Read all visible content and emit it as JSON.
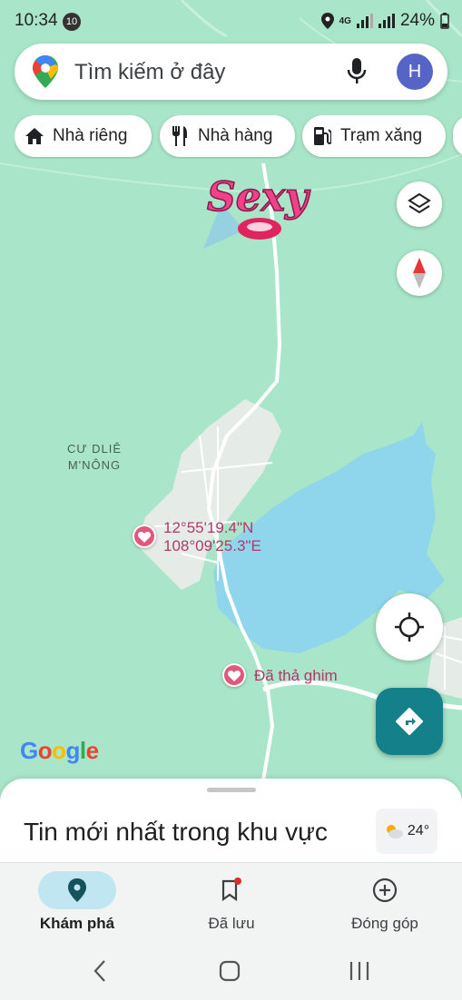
{
  "status_bar": {
    "time": "10:34",
    "notification_count": "10",
    "network": "4G",
    "battery": "24%"
  },
  "search": {
    "placeholder": "Tìm kiếm ở đây",
    "avatar_letter": "H"
  },
  "chips": [
    {
      "label": "Nhà riêng",
      "icon": "home-icon"
    },
    {
      "label": "Nhà hàng",
      "icon": "restaurant-icon"
    },
    {
      "label": "Trạm xăng",
      "icon": "gas-station-icon"
    }
  ],
  "map": {
    "place_label": [
      "CƯ DLIÊ",
      "M'NÔNG"
    ],
    "pins": [
      {
        "lines": [
          "12°55'19.4\"N",
          "108°09'25.3\"E"
        ]
      },
      {
        "lines": [
          "Đã thả ghim"
        ]
      }
    ],
    "sticker_text": "Sexy",
    "google_logo": "Google"
  },
  "sheet": {
    "title": "Tin mới nhất trong khu vực",
    "temperature": "24°"
  },
  "bottom_nav": [
    {
      "label": "Khám phá",
      "icon": "explore-pin-icon",
      "active": true
    },
    {
      "label": "Đã lưu",
      "icon": "saved-bookmark-icon",
      "active": false
    },
    {
      "label": "Đóng góp",
      "icon": "contribute-plus-icon",
      "active": false
    }
  ],
  "colors": {
    "map_green": "#a9e6c9",
    "water": "#8fd6ec",
    "accent_teal": "#14808a",
    "pin_pink": "#e2577c"
  }
}
